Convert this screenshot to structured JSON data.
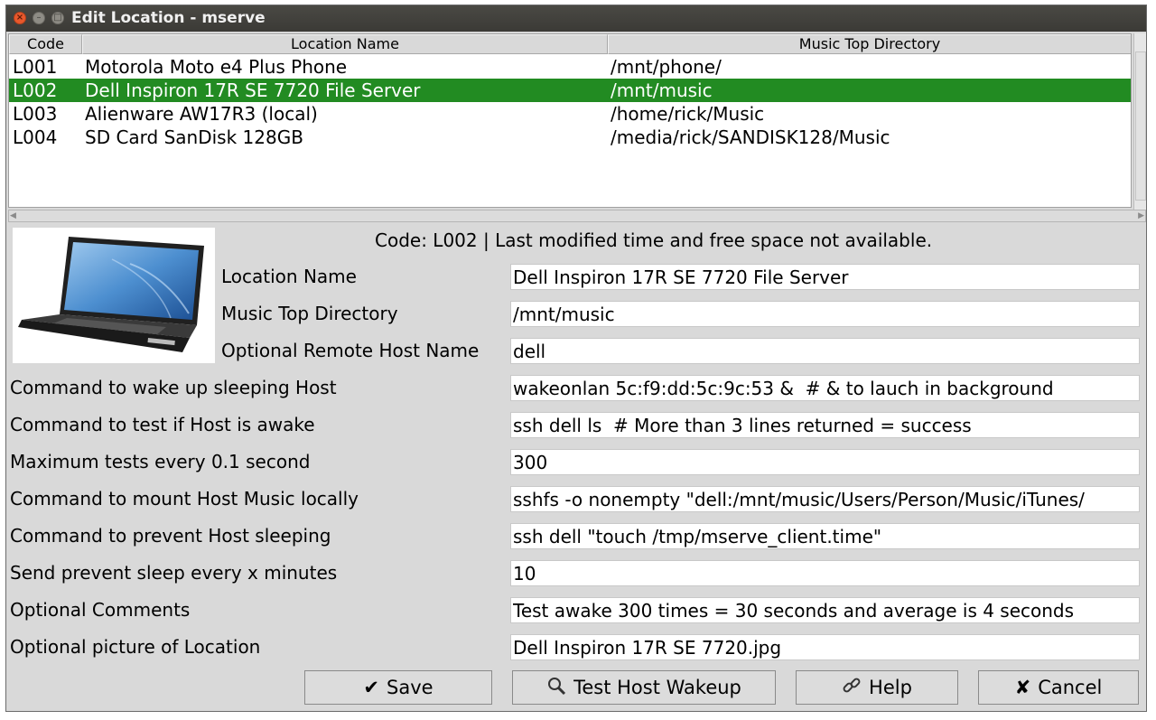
{
  "window": {
    "title": "Edit Location - mserve"
  },
  "table": {
    "headers": {
      "code": "Code",
      "name": "Location Name",
      "dir": "Music Top Directory"
    },
    "rows": [
      {
        "code": "L001",
        "name": "Motorola Moto e4 Plus Phone",
        "dir": "/mnt/phone/"
      },
      {
        "code": "L002",
        "name": "Dell Inspiron 17R SE 7720 File Server",
        "dir": "/mnt/music"
      },
      {
        "code": "L003",
        "name": "Alienware AW17R3 (local)",
        "dir": "/home/rick/Music"
      },
      {
        "code": "L004",
        "name": "SD Card SanDisk 128GB",
        "dir": "/media/rick/SANDISK128/Music"
      }
    ],
    "selected_code": "L002"
  },
  "detail": {
    "status": "Code: L002  | Last modified time and free space not available.",
    "fields": [
      {
        "label": "Location Name",
        "value": "Dell Inspiron 17R SE 7720 File Server"
      },
      {
        "label": "Music Top Directory",
        "value": "/mnt/music"
      },
      {
        "label": "Optional Remote Host Name",
        "value": "dell"
      },
      {
        "label": "Command to wake up sleeping Host",
        "value": "wakeonlan 5c:f9:dd:5c:9c:53 &  # & to lauch in background"
      },
      {
        "label": "Command to test if Host is awake",
        "value": "ssh dell ls  # More than 3 lines returned = success"
      },
      {
        "label": "Maximum tests every 0.1 second",
        "value": "300"
      },
      {
        "label": "Command to mount Host Music locally",
        "value": "sshfs -o nonempty \"dell:/mnt/music/Users/Person/Music/iTunes/"
      },
      {
        "label": "Command to prevent Host sleeping",
        "value": "ssh dell \"touch /tmp/mserve_client.time\""
      },
      {
        "label": "Send prevent sleep every x minutes",
        "value": "10"
      },
      {
        "label": "Optional Comments",
        "value": "Test awake 300 times = 30 seconds and average is 4 seconds"
      },
      {
        "label": "Optional picture of Location",
        "value": "Dell Inspiron 17R SE 7720.jpg"
      }
    ]
  },
  "buttons": {
    "save": {
      "icon": "✔",
      "label": "Save"
    },
    "test": {
      "icon": "🔍",
      "label": "Test Host Wakeup"
    },
    "help": {
      "icon": "🔗",
      "label": "Help"
    },
    "cancel": {
      "icon": "✘",
      "label": "Cancel"
    }
  },
  "colors": {
    "selection": "#228b22",
    "titlebar": "#3b3a36",
    "window_bg": "#d9d9d9"
  }
}
